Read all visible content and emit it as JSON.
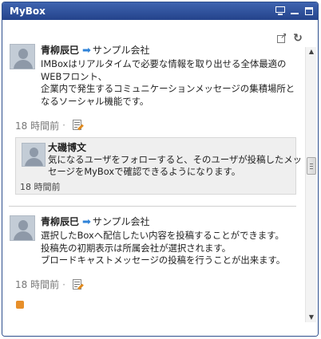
{
  "window": {
    "title": "MyBox",
    "controls": {
      "monitor": "monitor-icon",
      "minimize": "minimize-icon",
      "maximize": "maximize-icon"
    }
  },
  "toolbar": {
    "popout": "popout-icon",
    "refresh": "refresh-icon"
  },
  "posts": [
    {
      "author": "青柳辰巳",
      "arrow": "➡",
      "group": "サンプル会社",
      "lines": [
        "IMBoxはリアルタイムで必要な情報を取り出せる全体最適の",
        "WEBフロント、",
        "企業内で発生するコミュニケーションメッセージの集積場所と",
        "なるソーシャル機能です。"
      ],
      "time": "18 時間前",
      "separator": "·",
      "reply": {
        "author": "大磯博文",
        "lines": [
          "気になるユーザをフォローすると、そのユーザが投稿したメッ",
          "セージをMyBoxで確認できるようになります。"
        ],
        "time": "18 時間前"
      }
    },
    {
      "author": "青柳辰巳",
      "arrow": "➡",
      "group": "サンプル会社",
      "lines": [
        "選択したBoxへ配信したい内容を投稿することができます。",
        "投稿先の初期表示は所属会社が選択されます。",
        "ブロードキャストメッセージの投稿を行うことが出来ます。"
      ],
      "time": "18 時間前",
      "separator": "·"
    }
  ],
  "scrollbar": {
    "up": "▲",
    "down": "▼"
  }
}
